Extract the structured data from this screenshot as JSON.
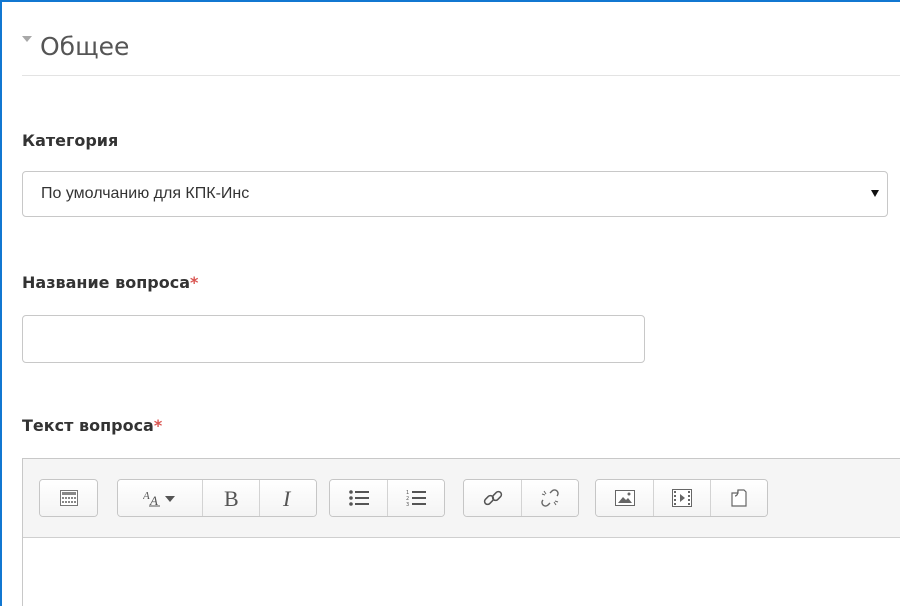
{
  "section": {
    "title": "Общее",
    "toggle_icon": "triangle-down-icon"
  },
  "category": {
    "label": "Категория",
    "selected": "По умолчанию для КПК-Инс"
  },
  "question_name": {
    "label": "Название вопроса",
    "required_mark": "*",
    "value": "",
    "placeholder": ""
  },
  "question_text": {
    "label": "Текст вопроса",
    "required_mark": "*",
    "toolbar_groups": [
      [
        "toggle-toolbar-icon"
      ],
      [
        "font-style-icon",
        "bold-icon",
        "italic-icon"
      ],
      [
        "unordered-list-icon",
        "ordered-list-icon"
      ],
      [
        "link-icon",
        "unlink-icon"
      ],
      [
        "image-icon",
        "media-icon",
        "manage-files-icon"
      ]
    ],
    "content": ""
  },
  "colors": {
    "accent_border": "#1177d1",
    "required": "#d9534f",
    "toolbar_bg": "#f5f5f5"
  }
}
